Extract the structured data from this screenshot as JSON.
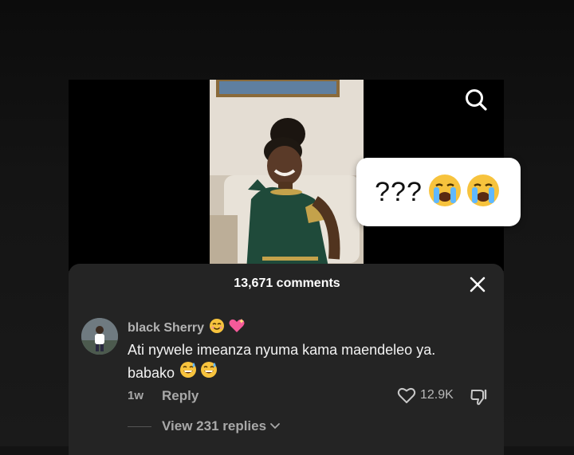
{
  "comments_panel": {
    "title": "13,671 comments",
    "comment": {
      "username": "black Sherry",
      "username_emojis": [
        "smiling-face-emoji",
        "sparkling-heart-emoji"
      ],
      "text_line1": "Ati nywele imeanza nyuma kama maendeleo ya.",
      "text_line2": "babako",
      "text_emojis": [
        "grinning-sweat-emoji",
        "grinning-sweat-emoji"
      ],
      "time": "1w",
      "reply_label": "Reply",
      "like_count": "12.9K",
      "view_replies_label": "View 231 replies"
    }
  },
  "overlay": {
    "bubble_text": "???",
    "bubble_emojis": [
      "loudly-crying-face-emoji",
      "loudly-crying-face-emoji"
    ]
  },
  "colors": {
    "panel_bg": "#242424",
    "page_bg": "#131313",
    "secondary_text": "#a8a8a8",
    "primary_text": "#ffffff"
  },
  "icons": [
    "search-icon",
    "close-icon",
    "heart-icon",
    "dislike-icon",
    "chevron-down-icon"
  ]
}
